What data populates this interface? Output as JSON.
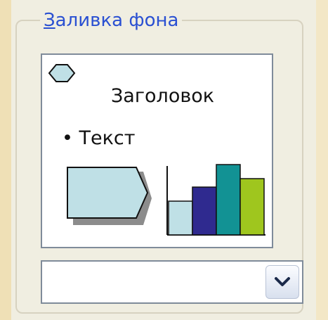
{
  "group": {
    "legend_accel": "З",
    "legend_rest": "аливка фона"
  },
  "preview": {
    "title": "Заголовок",
    "bullet_text": "• Текст",
    "bar_heights_relative": [
      0.38,
      0.6,
      0.92,
      0.7
    ],
    "colors": {
      "bar1": "#bfe0e6",
      "bar2": "#2f2a8f",
      "bar3": "#129294",
      "bar4": "#9fc61e",
      "shape_fill": "#bfe0e6",
      "shape_shadow": "#8c8c8c",
      "outline": "#111111"
    }
  },
  "combo": {
    "value": "",
    "arrow_icon": "chevron-down-icon"
  },
  "theme": {
    "legend_color": "#2a50d2",
    "background": "#f3e7c6"
  }
}
